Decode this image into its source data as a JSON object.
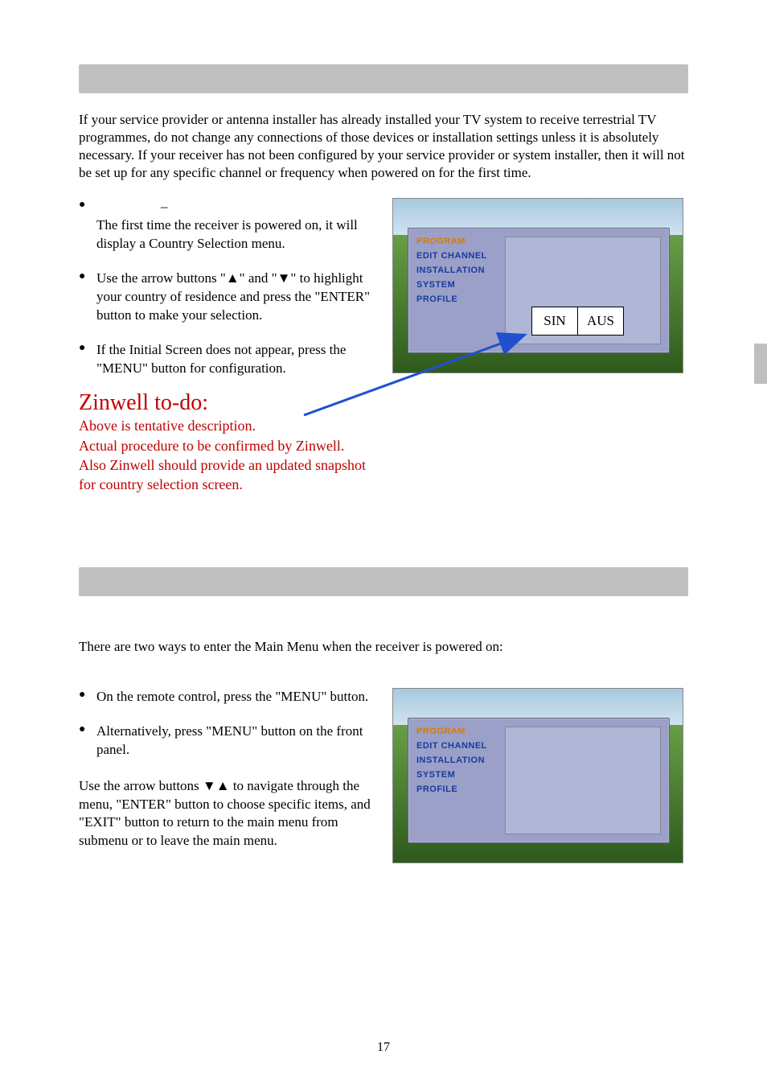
{
  "section1": {
    "intro": "If your service provider or antenna installer has already installed your TV system to receive terrestrial TV programmes, do not change any connections of those devices or installation settings unless it is absolutely necessary. If your receiver has not been configured by your service provider or system installer, then it will not be set up for any specific channel or frequency when powered on for the first time.",
    "bullet1_heading": "–",
    "bullet1_body": "The first time the receiver is powered on, it will display a Country Selection menu.",
    "bullet2": "Use the arrow buttons \"▲\" and \"▼\" to highlight your country of residence and press the \"ENTER\" button to make your selection.",
    "bullet3": "If the Initial Screen does not appear, press the \"MENU\" button for configuration.",
    "todo_heading": "Zinwell to-do:",
    "todo_body": "Above is tentative description.\nActual procedure to be confirmed by Zinwell.\nAlso Zinwell should provide an updated snapshot for country selection screen."
  },
  "section2": {
    "intro": "There are two ways to enter the Main Menu when the receiver is powered on:",
    "bullet1": "On the remote control, press the \"MENU\" button.",
    "bullet2": "Alternatively, press \"MENU\" button on the front panel.",
    "nav_text": "Use the arrow buttons ▼▲ to navigate through the menu, \"ENTER\" button to choose specific items, and \"EXIT\" button to return to the main menu from submenu or to leave the main menu."
  },
  "menu": {
    "items": [
      "PROGRAM",
      "EDIT CHANNEL",
      "INSTALLATION",
      "SYSTEM",
      "PROFILE"
    ]
  },
  "country_options": [
    "SIN",
    "AUS"
  ],
  "page_number": "17"
}
